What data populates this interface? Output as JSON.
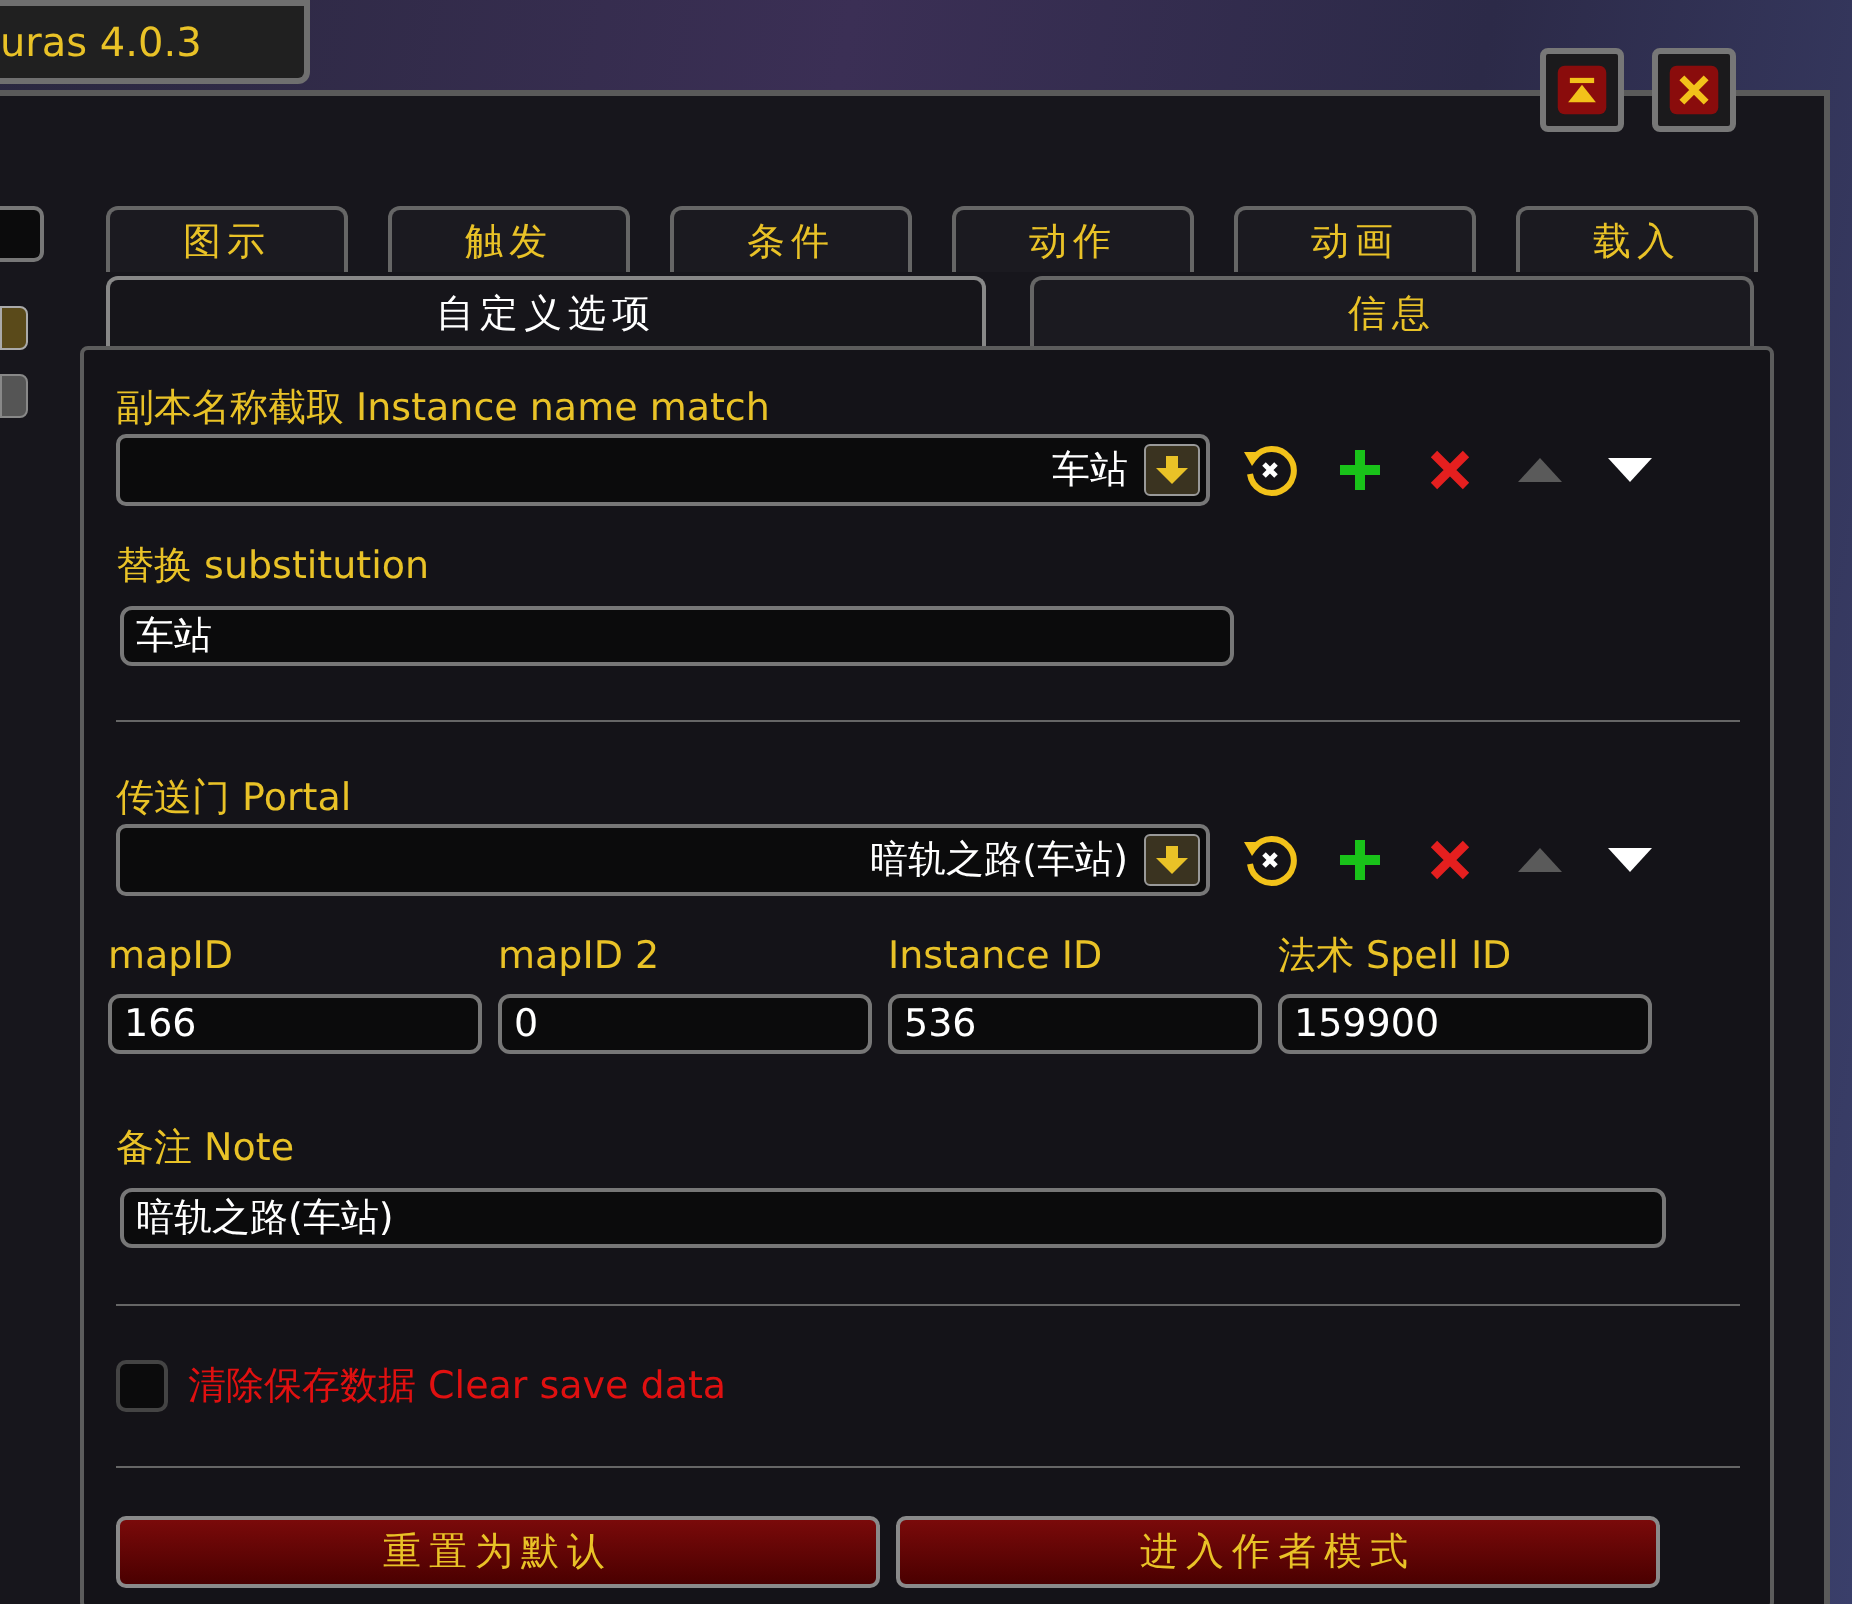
{
  "title": "uras 4.0.3",
  "window_buttons": [
    {
      "kind": "collapse"
    },
    {
      "kind": "close"
    }
  ],
  "tabs_row1": [
    {
      "label": "图示",
      "selected": false
    },
    {
      "label": "触发",
      "selected": false
    },
    {
      "label": "条件",
      "selected": false
    },
    {
      "label": "动作",
      "selected": false
    },
    {
      "label": "动画",
      "selected": false
    },
    {
      "label": "载入",
      "selected": false
    }
  ],
  "tabs_row2": [
    {
      "label": "自定义选项",
      "selected": true
    },
    {
      "label": "信息",
      "selected": false
    }
  ],
  "instance_match": {
    "label": "副本名称截取 Instance name match",
    "value": "车站",
    "up_disabled": true,
    "down_disabled": false
  },
  "substitution": {
    "label": "替换 substitution",
    "value": "车站"
  },
  "portal": {
    "label": "传送门 Portal",
    "value": "暗轨之路(车站)",
    "up_disabled": true,
    "down_disabled": false
  },
  "ids": [
    {
      "label": "mapID",
      "value": "166"
    },
    {
      "label": "mapID 2",
      "value": "0"
    },
    {
      "label": "Instance ID",
      "value": "536"
    },
    {
      "label": "法术 Spell ID",
      "value": "159900"
    }
  ],
  "note": {
    "label": "备注 Note",
    "value": "暗轨之路(车站)"
  },
  "clear_save": {
    "label": "清除保存数据 Clear save data",
    "checked": false
  },
  "buttons": [
    "重置为默认",
    "进入作者模式"
  ]
}
